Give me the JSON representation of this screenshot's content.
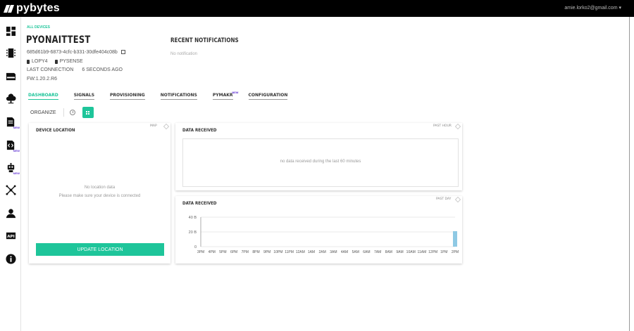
{
  "app": {
    "logo_text": "pybytes",
    "user_email": "amie.lorko2@gmail.com ▾"
  },
  "sidebar": {
    "items": [
      {
        "name": "dashboard-icon",
        "new": ""
      },
      {
        "name": "devices-icon",
        "new": ""
      },
      {
        "name": "sim-card-icon",
        "new": ""
      },
      {
        "name": "cloud-icon",
        "new": ""
      },
      {
        "name": "document-new-icon",
        "new": "NEW"
      },
      {
        "name": "code-file-icon",
        "new": "NEW"
      },
      {
        "name": "robot-icon",
        "new": "NEW"
      },
      {
        "name": "network-icon",
        "new": ""
      },
      {
        "name": "user-icon",
        "new": ""
      },
      {
        "name": "api-icon",
        "new": ""
      },
      {
        "name": "info-icon",
        "new": ""
      }
    ]
  },
  "breadcrumb": "ALL DEVICES",
  "device": {
    "name": "PYONAITTEST",
    "id": "685d61b9-6873-4cfc-b331-30dfe404c08b",
    "tags": [
      "LOPY4",
      "PYSENSE"
    ],
    "last_connection_label": "LAST CONNECTION",
    "last_connection_value": "6 SECONDS AGO",
    "firmware": "FW:1.20.2.R6"
  },
  "notifications": {
    "title": "RECENT NOTIFICATIONS",
    "empty": "No notification"
  },
  "tabs": [
    {
      "label": "DASHBOARD",
      "active": true,
      "sup": ""
    },
    {
      "label": "SIGNALS",
      "active": false,
      "sup": ""
    },
    {
      "label": "PROVISIONING",
      "active": false,
      "sup": ""
    },
    {
      "label": "NOTIFICATIONS",
      "active": false,
      "sup": ""
    },
    {
      "label": "PYMAKR",
      "active": false,
      "sup": "NEW"
    },
    {
      "label": "CONFIGURATION",
      "active": false,
      "sup": ""
    }
  ],
  "organize": {
    "label": "ORGANIZE"
  },
  "widgets": {
    "location": {
      "title": "DEVICE LOCATION",
      "sub": "MAP",
      "empty_line1": "No location data",
      "empty_line2": "Please make sure your device is connected",
      "button": "UPDATE LOCATION"
    },
    "hour": {
      "title": "DATA RECEIVED",
      "sub": "PAST HOUR",
      "empty": "no data received during the last 60 minutes"
    },
    "day": {
      "title": "DATA RECEIVED",
      "sub": "PAST DAY"
    }
  },
  "chart_data": {
    "type": "bar",
    "title": "DATA RECEIVED",
    "subtitle": "PAST DAY",
    "categories": [
      "3PM",
      "4PM",
      "5PM",
      "6PM",
      "7PM",
      "8PM",
      "9PM",
      "10PM",
      "11PM",
      "12AM",
      "1AM",
      "2AM",
      "3AM",
      "4AM",
      "5AM",
      "6AM",
      "7AM",
      "8AM",
      "9AM",
      "10AM",
      "11AM",
      "12PM",
      "1PM",
      "2PM"
    ],
    "values": [
      0,
      0,
      0,
      0,
      0,
      0,
      0,
      0,
      0,
      0,
      0,
      0,
      0,
      0,
      0,
      0,
      0,
      0,
      0,
      0,
      0,
      0,
      0,
      21
    ],
    "yticks": [
      "0",
      "20 B",
      "40 B"
    ],
    "ylim": [
      0,
      40
    ],
    "grid": true,
    "bar_color": "#8ec9e4",
    "xlabel": "",
    "ylabel": ""
  },
  "colors": {
    "accent": "#1ec59a",
    "new_badge": "#6a3fd6"
  }
}
